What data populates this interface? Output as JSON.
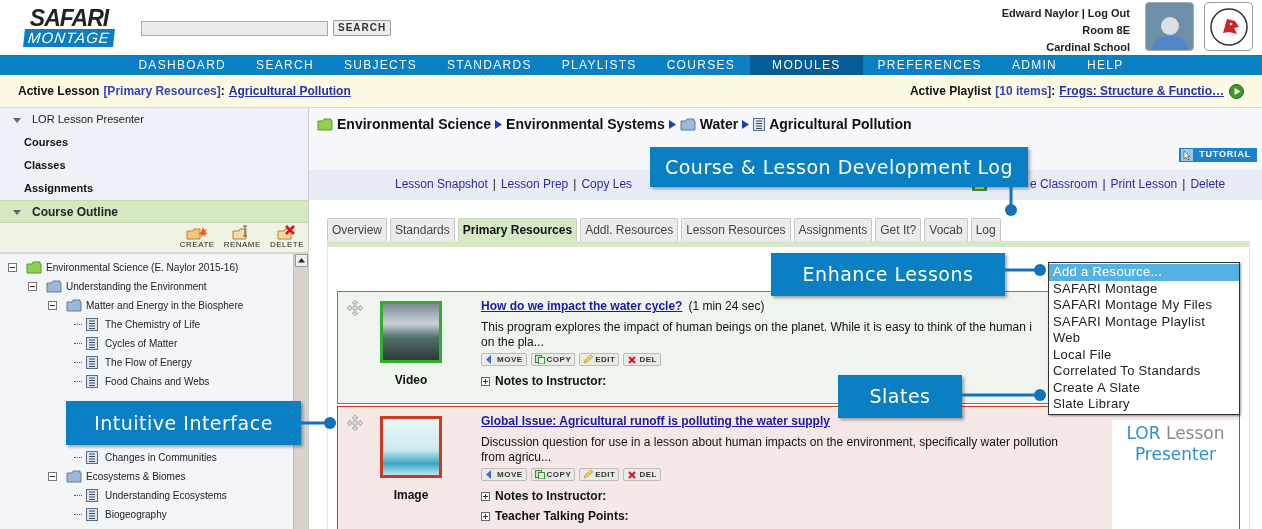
{
  "header": {
    "logo": {
      "top": "SAFARI",
      "bottom": "MONTAGE"
    },
    "search": {
      "button": "SEARCH"
    },
    "user": {
      "name": "Edward Naylor",
      "logout": "Log Out",
      "separator": "|",
      "room": "Room 8E",
      "school": "Cardinal School"
    }
  },
  "nav": [
    {
      "label": "DASHBOARD",
      "selected": false
    },
    {
      "label": "SEARCH",
      "selected": false
    },
    {
      "label": "SUBJECTS",
      "selected": false
    },
    {
      "label": "STANDARDS",
      "selected": false
    },
    {
      "label": "PLAYLISTS",
      "selected": false
    },
    {
      "label": "COURSES",
      "selected": false
    },
    {
      "label": "MODULES",
      "selected": true
    },
    {
      "label": "PREFERENCES",
      "selected": false
    },
    {
      "label": "ADMIN",
      "selected": false
    },
    {
      "label": "HELP",
      "selected": false
    }
  ],
  "active_bar": {
    "lesson": {
      "label": "Active Lesson",
      "tag": "[Primary Resources]",
      "colon": ":",
      "link": "Agricultural Pollution"
    },
    "playlist": {
      "label": "Active Playlist",
      "tag": "[10 items]",
      "colon": ":",
      "link": "Frogs: Structure & Functio…"
    }
  },
  "sidebar": {
    "items": [
      {
        "label": "LOR Lesson Presenter",
        "kind": "section",
        "expanded": true,
        "selected": false
      },
      {
        "label": "Courses",
        "kind": "link",
        "selected": false
      },
      {
        "label": "Classes",
        "kind": "link",
        "selected": false
      },
      {
        "label": "Assignments",
        "kind": "link",
        "selected": false
      },
      {
        "label": "Course Outline",
        "kind": "section",
        "expanded": true,
        "selected": true
      }
    ],
    "toolbar": [
      {
        "label": "CREATE",
        "kind": "create"
      },
      {
        "label": "RENAME",
        "kind": "rename"
      },
      {
        "label": "DELETE",
        "kind": "delete"
      }
    ],
    "tree": [
      {
        "label": "Environmental Science (E. Naylor 2015-16)",
        "kind": "course",
        "expanded": true,
        "children": [
          {
            "label": "Understanding the Environment",
            "kind": "folder",
            "expanded": true,
            "children": [
              {
                "label": "Matter and Energy in the Biosphere",
                "kind": "folder",
                "expanded": true,
                "children": [
                  {
                    "label": "The Chemistry of Life",
                    "kind": "lesson"
                  },
                  {
                    "label": "Cycles of Matter",
                    "kind": "lesson"
                  },
                  {
                    "label": "The Flow of Energy",
                    "kind": "lesson"
                  },
                  {
                    "label": "Food Chains and Webs",
                    "kind": "lesson"
                  }
                ]
              },
              {
                "kind": "covered",
                "children": [
                  {
                    "kind": "covered"
                  },
                  {
                    "kind": "covered"
                  },
                  {
                    "label": "Changes in Communities",
                    "kind": "lesson"
                  }
                ]
              },
              {
                "label": "Ecosystems & Biomes",
                "kind": "folder",
                "expanded": true,
                "children": [
                  {
                    "label": "Understanding Ecosystems",
                    "kind": "lesson"
                  },
                  {
                    "label": "Biogeography",
                    "kind": "lesson"
                  }
                ]
              }
            ]
          }
        ]
      }
    ]
  },
  "breadcrumb": [
    {
      "label": "Environmental Science",
      "kind": "course"
    },
    {
      "label": "Environmental Systems",
      "kind": "plain"
    },
    {
      "label": "Water",
      "kind": "folder"
    },
    {
      "label": "Agricultural Pollution",
      "kind": "lesson"
    }
  ],
  "tutorial_button": "TUTORIAL",
  "lesson_links": [
    {
      "label": "Lesson Snapshot",
      "kind": "link"
    },
    {
      "label": "|",
      "kind": "separator"
    },
    {
      "label": "Lesson Prep",
      "kind": "link"
    },
    {
      "label": "|",
      "kind": "separator"
    },
    {
      "label": "Copy Les",
      "kind": "link"
    },
    {
      "kind": "gap"
    },
    {
      "label": "e Classroom",
      "kind": "icon_link"
    },
    {
      "label": "|",
      "kind": "separator"
    },
    {
      "label": "Print Lesson",
      "kind": "link"
    },
    {
      "label": "|",
      "kind": "separator"
    },
    {
      "label": "Delete",
      "kind": "link"
    }
  ],
  "tabs": [
    {
      "label": "Overview",
      "selected": false
    },
    {
      "label": "Standards",
      "selected": false
    },
    {
      "label": "Primary Resources",
      "selected": true
    },
    {
      "label": "Addl. Resources",
      "selected": false
    },
    {
      "label": "Lesson Resources",
      "selected": false
    },
    {
      "label": "Assignments",
      "selected": false
    },
    {
      "label": "Get It?",
      "selected": false
    },
    {
      "label": "Vocab",
      "selected": false
    },
    {
      "label": "Log",
      "selected": false
    }
  ],
  "resources": [
    {
      "kind": "video",
      "type_label": "Video",
      "title": "How do we impact the water cycle?",
      "duration": "(1 min 24 sec)",
      "lines": [
        "This program explores the impact of human beings on the planet. While it is easy to think of the human i",
        "on the pla..."
      ],
      "actions": [
        {
          "label": "MOVE",
          "kind": "move"
        },
        {
          "label": "COPY",
          "kind": "copy"
        },
        {
          "label": "EDIT",
          "kind": "edit"
        },
        {
          "label": "DEL",
          "kind": "delete"
        }
      ],
      "notes": [
        "Notes to Instructor:"
      ]
    },
    {
      "kind": "image",
      "type_label": "Image",
      "title": "Global Issue: Agricultural runoff is polluting the water supply",
      "lines": [
        "Discussion question for use in a lesson about human impacts on the environment, specifically water pollution",
        "from agricu..."
      ],
      "actions": [
        {
          "label": "MOVE",
          "kind": "move"
        },
        {
          "label": "COPY",
          "kind": "copy"
        },
        {
          "label": "EDIT",
          "kind": "edit"
        },
        {
          "label": "DEL",
          "kind": "delete"
        }
      ],
      "notes": [
        "Notes to Instructor:",
        "Teacher Talking Points:"
      ]
    }
  ],
  "add_menu": [
    {
      "label": "Add a Resource...",
      "selected": true
    },
    {
      "label": "SAFARI Montage",
      "selected": false
    },
    {
      "label": "SAFARI Montage My Files",
      "selected": false
    },
    {
      "label": "SAFARI Montage Playlist",
      "selected": false
    },
    {
      "label": "Web",
      "selected": false
    },
    {
      "label": "Local File",
      "selected": false
    },
    {
      "label": "Correlated To Standards",
      "selected": false
    },
    {
      "label": "Create A Slate",
      "selected": false
    },
    {
      "label": "Slate Library",
      "selected": false
    }
  ],
  "brand_caption": [
    {
      "text": "LOR",
      "kind": "accent"
    },
    {
      "text": "Lesson",
      "kind": "muted"
    },
    {
      "text": "Presenter",
      "kind": "accent"
    }
  ],
  "callouts": [
    {
      "text": "Course & Lesson Development Log",
      "kind": "log"
    },
    {
      "text": "Enhance Lessons",
      "kind": "enhance"
    },
    {
      "text": "Slates",
      "kind": "slates"
    },
    {
      "text": "Intuitive Interface",
      "kind": "interface"
    }
  ]
}
